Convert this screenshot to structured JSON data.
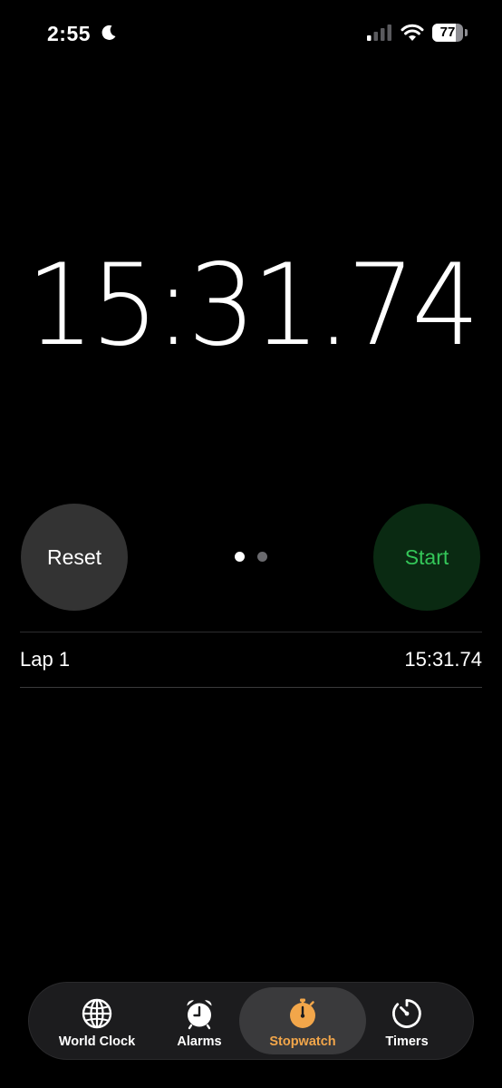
{
  "status_bar": {
    "time": "2:55",
    "battery_level": "77",
    "battery_fraction": 0.77,
    "icons": [
      "moon-icon",
      "cellular-signal-icon",
      "wifi-icon",
      "battery-icon"
    ]
  },
  "stopwatch": {
    "elapsed": "15:31.74",
    "reset_label": "Reset",
    "start_label": "Start",
    "page_indicator": {
      "count": 2,
      "active": 0
    }
  },
  "laps": [
    {
      "label": "Lap 1",
      "time": "15:31.74"
    }
  ],
  "tab_bar": {
    "tabs": [
      {
        "label": "World Clock",
        "icon": "globe-icon",
        "selected": false
      },
      {
        "label": "Alarms",
        "icon": "alarm-clock-icon",
        "selected": false
      },
      {
        "label": "Stopwatch",
        "icon": "stopwatch-icon",
        "selected": true
      },
      {
        "label": "Timers",
        "icon": "timer-icon",
        "selected": false
      }
    ]
  },
  "colors": {
    "background": "#000000",
    "accent_orange": "#f2a64a",
    "start_green": "#34c759",
    "start_bg": "#0a2a12",
    "reset_bg": "#333333"
  }
}
